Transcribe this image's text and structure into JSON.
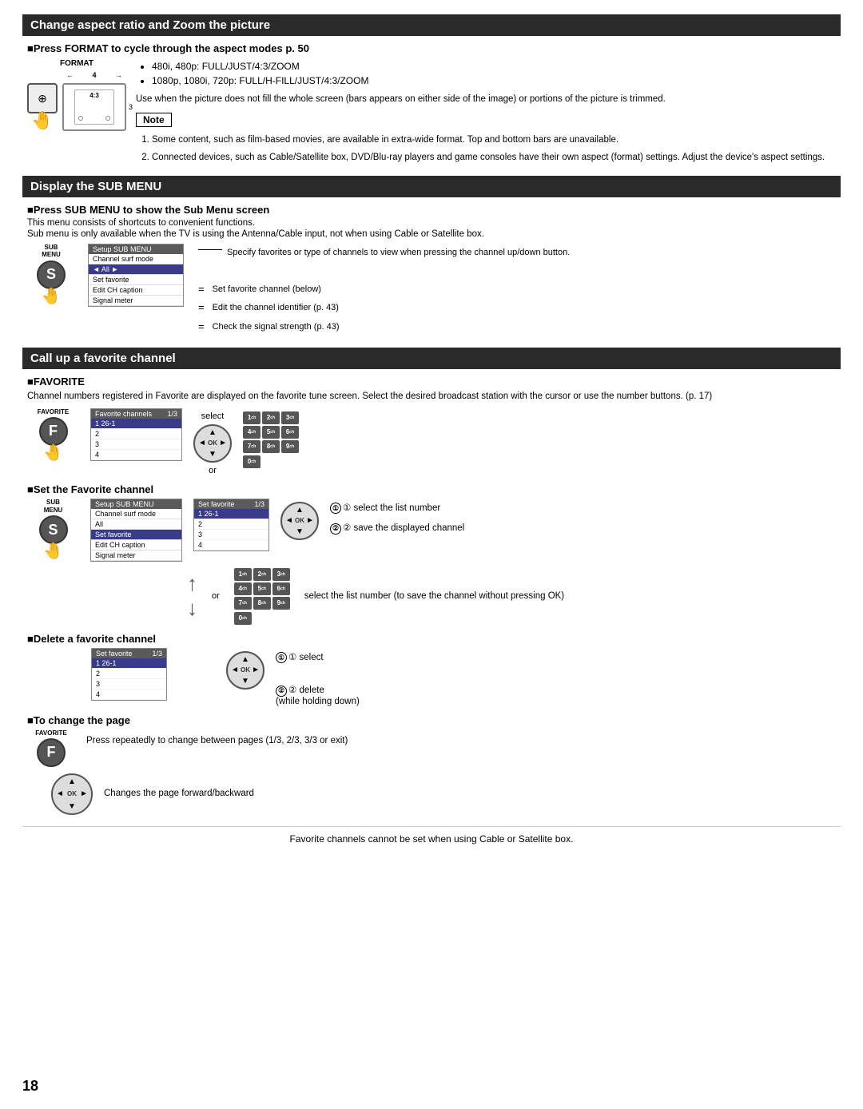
{
  "page": {
    "number": "18",
    "footer": "Favorite channels cannot be set when using Cable or Satellite box."
  },
  "section1": {
    "title": "Change aspect ratio and Zoom the picture",
    "subsection1": {
      "title": "■Press FORMAT to cycle through the aspect modes",
      "page_ref": "p. 50",
      "format_label": "FORMAT",
      "bullets": [
        "480i, 480p: FULL/JUST/4:3/ZOOM",
        "1080p, 1080i, 720p: FULL/H-FILL/JUST/4:3/ZOOM"
      ],
      "body_text": "Use when the picture does not fill the whole screen (bars appears on either side of the image) or portions of the picture is trimmed.",
      "note_label": "Note",
      "notes": [
        "Some content, such as film-based movies, are available in extra-wide format. Top and bottom bars are unavailable.",
        "Connected devices, such as Cable/Satellite box, DVD/Blu-ray players and game consoles have their own aspect (format) settings. Adjust the device's aspect settings."
      ]
    }
  },
  "section2": {
    "title": "Display the SUB MENU",
    "subsection1": {
      "title": "■Press SUB MENU to show the Sub Menu screen",
      "body": "This menu consists of shortcuts to convenient functions.",
      "body2": "Sub menu is only available when the TV is using the Antenna/Cable input, not when using Cable or Satellite box.",
      "sub_label": "SUB\nMENU",
      "menu_title": "Setup SUB MENU",
      "menu_items": [
        {
          "label": "Channel surf mode",
          "annotation": "Specify favorites or type of channels to view when pressing the channel up/down button.",
          "selected": false
        },
        {
          "label": "◄  All  ►",
          "annotation": "",
          "selected": true
        },
        {
          "label": "Set favorite",
          "annotation": "Set favorite channel (below)",
          "selected": false
        },
        {
          "label": "Edit CH caption",
          "annotation": "Edit the channel identifier (p. 43)",
          "selected": false
        },
        {
          "label": "Signal meter",
          "annotation": "Check the signal strength (p. 43)",
          "selected": false
        }
      ]
    }
  },
  "section3": {
    "title": "Call up a favorite channel",
    "favorite_subsection": {
      "title": "■FAVORITE",
      "body": "Channel numbers registered in Favorite are displayed on the favorite tune screen. Select the desired broadcast station with the cursor or use the number buttons. (p. 17)",
      "fav_label": "FAVORITE",
      "fav_channels_title": "Favorite channels",
      "fav_page": "1/3",
      "fav_items": [
        "1  26-1",
        "2",
        "3",
        "4"
      ],
      "select_label": "select",
      "or_label": "or"
    },
    "set_favorite": {
      "title": "■Set the Favorite channel",
      "sub_label": "SUB\nMENU",
      "menu_title": "Setup SUB MENU",
      "menu_items": [
        {
          "label": "Channel surf mode",
          "selected": false
        },
        {
          "label": "All",
          "selected": false
        },
        {
          "label": "Set favorite",
          "selected": true
        },
        {
          "label": "Edit CH caption",
          "selected": false
        },
        {
          "label": "Signal meter",
          "selected": false
        }
      ],
      "set_fav_title": "Set favorite",
      "set_fav_page": "1/3",
      "set_fav_items": [
        "1  26-1",
        "2",
        "3",
        "4"
      ],
      "step1": "① select the list number",
      "step2": "② save the displayed channel",
      "or_label": "or",
      "alt_instruction": "select the list number (to save the channel without pressing OK)"
    },
    "delete_favorite": {
      "title": "■Delete a favorite channel",
      "set_fav_title": "Set favorite",
      "set_fav_page": "1/3",
      "set_fav_items": [
        "1  26-1",
        "2",
        "3",
        "4"
      ],
      "step1": "① select",
      "step2": "② delete\n(while holding down)"
    },
    "change_page": {
      "title": "■To change the page",
      "fav_label": "FAVORITE",
      "body": "Press repeatedly to change between pages (1/3, 2/3, 3/3 or exit)",
      "body2": "Changes the page forward/backward"
    }
  }
}
